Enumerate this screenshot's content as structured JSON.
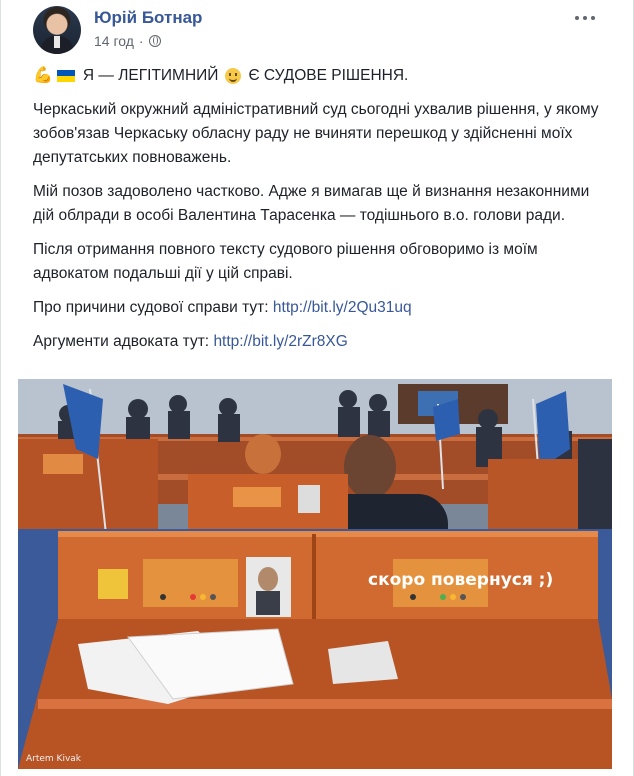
{
  "post": {
    "author": "Юрій Ботнар",
    "time": "14 год",
    "headline_emoji": "💪",
    "headline_text_1": "Я — ЛЕГІТИМНИЙ",
    "headline_text_2": "Є СУДОВЕ РІШЕННЯ.",
    "paragraphs": [
      "Черкаський окружний адміністративний суд сьогодні ухвалив рішення, у якому зобов'язав Черкаську обласну раду не вчиняти перешкод у здійсненні моїх депутатських повноважень.",
      "Мій позов задоволено частково. Адже я вимагав ще й визнання незаконними дій облради в особі Валентина Тарасенка — тодішнього в.о. голови ради.",
      "Після отримання повного тексту судового рішення обговоримо із моїм адвокатом подальші дії у цій справі."
    ],
    "link1_label": "Про причини судової справи тут:",
    "link1_url": "http://bit.ly/2Qu31uq",
    "link2_label": "Аргументи адвоката тут:",
    "link2_url": "http://bit.ly/2rZr8XG"
  },
  "photo": {
    "sign_text": "скоро повернуся ;)",
    "credit": "Artem Kivak"
  },
  "icons": {
    "more": "more-dots-icon",
    "privacy": "globe-icon"
  },
  "colors": {
    "link": "#385898",
    "text": "#1d2129",
    "meta": "#606770",
    "desk": "#c8602b"
  }
}
